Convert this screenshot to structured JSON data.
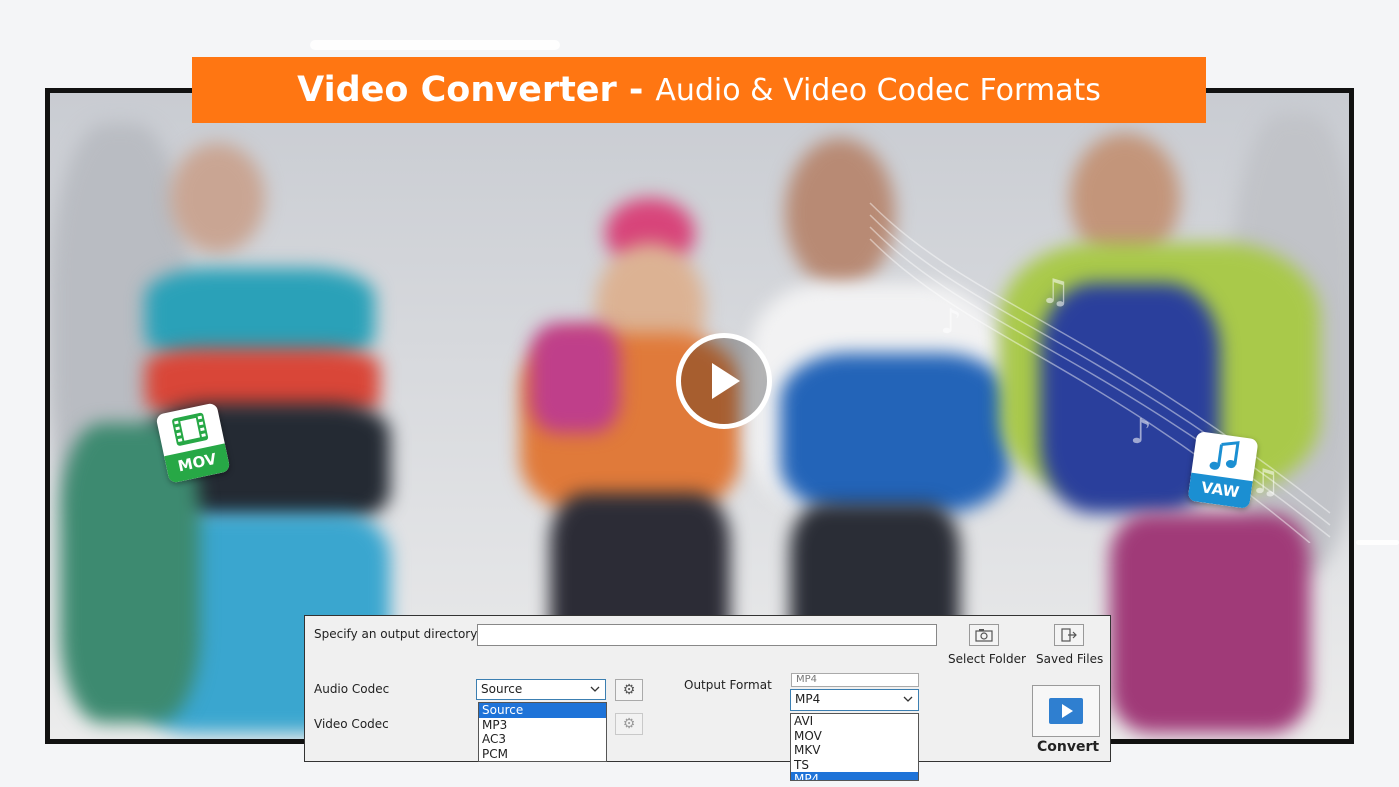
{
  "banner": {
    "title_bold": "Video Converter",
    "separator": "-",
    "title_rest": "Audio & Video Codec Formats",
    "color": "#ff7612"
  },
  "badges": {
    "mov": {
      "text": "MOV",
      "icon": "film-icon",
      "color": "#27a846"
    },
    "wav": {
      "text": "VAW",
      "icon": "music-note-icon",
      "color": "#1b8fd2"
    }
  },
  "dialog": {
    "output_dir_label": "Specify an output directory",
    "output_dir_value": "",
    "select_folder_label": "Select Folder",
    "saved_files_label": "Saved Files",
    "audio_codec_label": "Audio Codec",
    "audio_codec_value": "Source",
    "audio_codec_options": [
      "Source",
      "MP3",
      "AC3",
      "PCM"
    ],
    "video_codec_label": "Video Codec",
    "output_format_label": "Output Format",
    "output_format_behind": "MP4",
    "output_format_value": "MP4",
    "output_format_options": [
      "AVI",
      "MOV",
      "MKV",
      "TS",
      "MP4"
    ],
    "convert_label": "Convert"
  }
}
